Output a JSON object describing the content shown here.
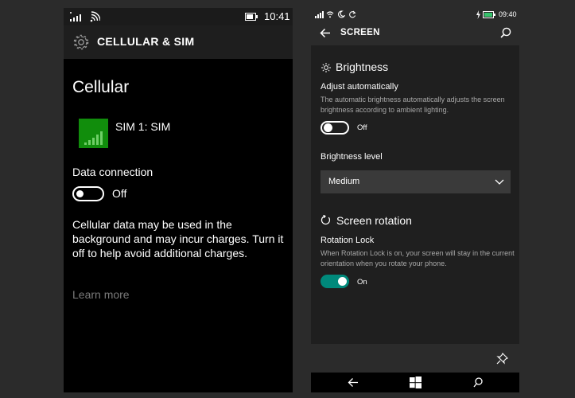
{
  "left": {
    "status": {
      "time": "10:41"
    },
    "header": {
      "title": "CELLULAR & SIM",
      "icon": "gear-icon"
    },
    "heading": "Cellular",
    "sim": {
      "label": "SIM 1: SIM",
      "tile_color": "#118d0c"
    },
    "data_connection": {
      "label": "Data connection",
      "state": "Off",
      "enabled": false
    },
    "description": "Cellular data may be used in the background and may incur charges. Turn it off to help avoid additional charges.",
    "learn_more": "Learn more"
  },
  "right": {
    "status": {
      "time": "09:40"
    },
    "header": {
      "title": "SCREEN"
    },
    "brightness": {
      "section_title": "Brightness",
      "adjust_label": "Adjust automatically",
      "adjust_desc": "The automatic brightness automatically adjusts the screen brightness according to ambient lighting.",
      "adjust_state": "Off",
      "adjust_enabled": false,
      "level_label": "Brightness level",
      "level_value": "Medium"
    },
    "rotation": {
      "section_title": "Screen rotation",
      "lock_label": "Rotation Lock",
      "lock_desc": "When Rotation Lock is on, your screen will stay in the current orientation when you rotate your phone.",
      "lock_state": "On",
      "lock_enabled": true
    },
    "accent_color": "#00897b"
  }
}
